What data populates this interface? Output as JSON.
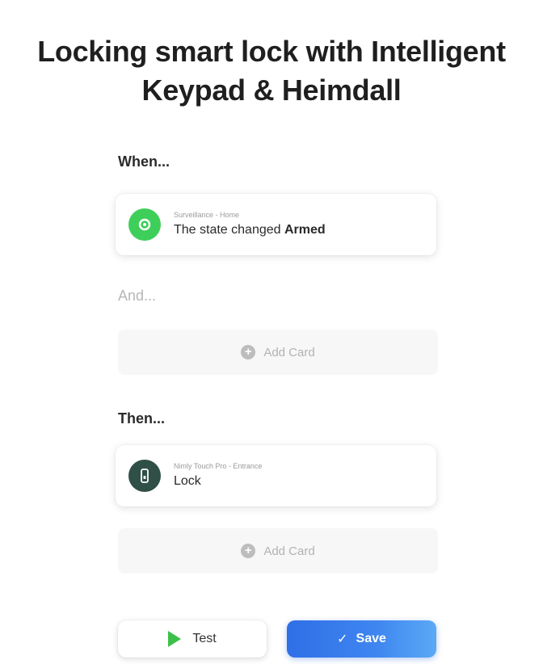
{
  "title": {
    "line1": "Locking smart lock with Intelligent",
    "line2": "Keypad & Heimdall"
  },
  "when": {
    "label": "When...",
    "card": {
      "subtitle": "Surveillance - Home",
      "text_prefix": "The state changed",
      "text_value": "Armed",
      "icon": "shield-icon",
      "icon_color": "#3ecf5a"
    }
  },
  "and": {
    "label": "And...",
    "add_card_label": "Add Card"
  },
  "then": {
    "label": "Then...",
    "card": {
      "subtitle": "Nimly Touch Pro - Entrance",
      "text": "Lock",
      "icon": "door-lock-icon",
      "icon_color": "#2f4f47"
    },
    "add_card_label": "Add Card"
  },
  "buttons": {
    "test_label": "Test",
    "save_label": "Save",
    "test_icon": "play-icon",
    "save_icon": "check-icon",
    "save_color": "#3f86f0"
  }
}
